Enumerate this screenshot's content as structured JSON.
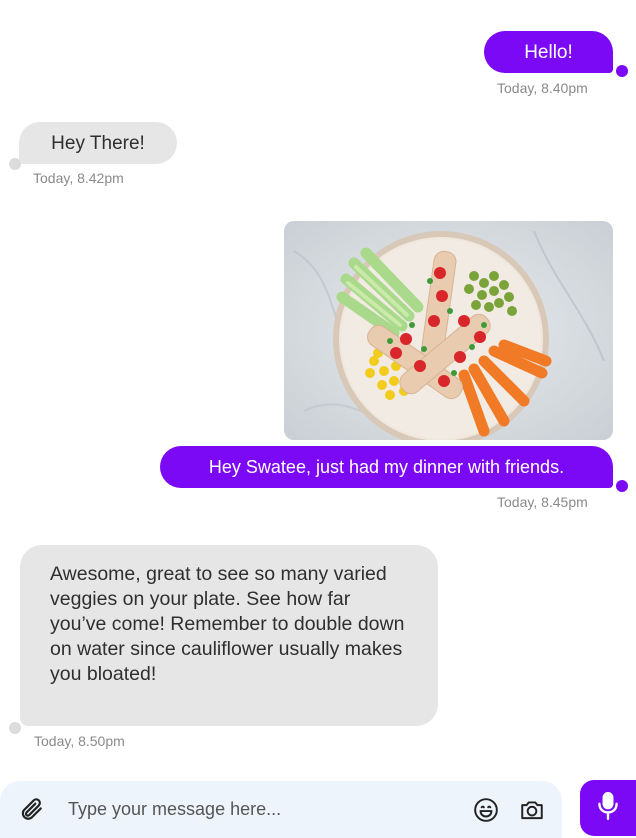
{
  "colors": {
    "accent": "#7b09f5",
    "incoming_bubble": "#e6e6e6",
    "composer_bg": "#eef4fb"
  },
  "messages": [
    {
      "direction": "outgoing",
      "text": "Hello!",
      "time": "Today, 8.40pm"
    },
    {
      "direction": "incoming",
      "text": "Hey There!",
      "time": "Today, 8.42pm"
    },
    {
      "direction": "outgoing",
      "type": "image",
      "image_desc": "dinner plate with veggies",
      "text": "Hey Swatee, just had my dinner with friends.",
      "time": "Today, 8.45pm"
    },
    {
      "direction": "incoming",
      "text": "Awesome, great to see so many varied veggies on your plate. See how far you’ve come! Remember to double down on water since cauliflower usually makes you bloated!",
      "time": "Today, 8.50pm"
    }
  ],
  "composer": {
    "placeholder": "Type your message here...",
    "icons": [
      "paperclip-icon",
      "emoji-icon",
      "camera-icon",
      "microphone-icon"
    ]
  }
}
